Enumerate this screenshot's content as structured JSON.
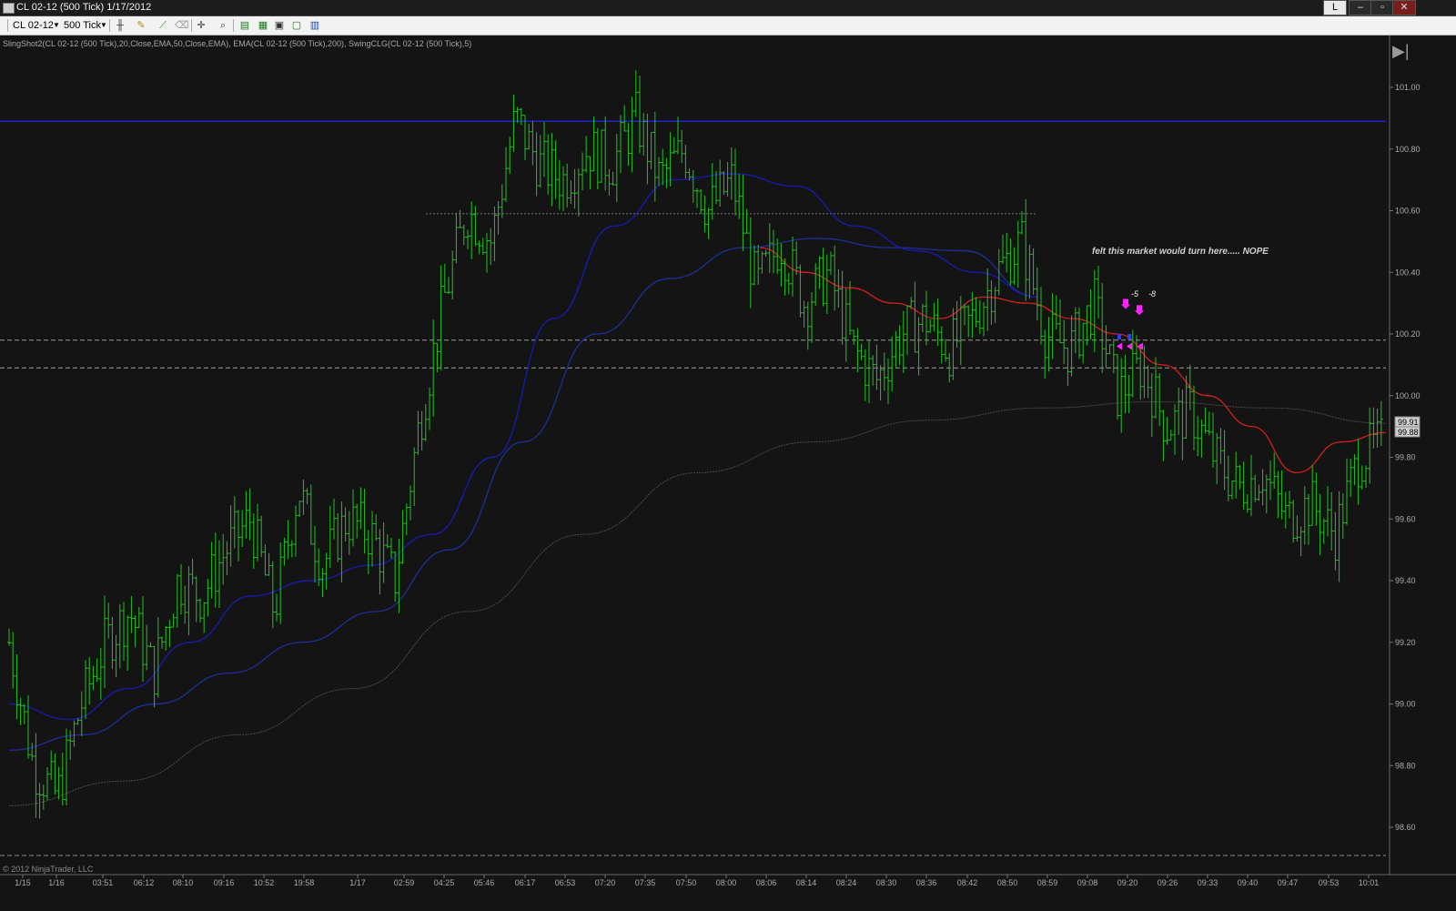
{
  "window": {
    "title": "CL 02-12 (500 Tick)  1/17/2012",
    "buttons": [
      "L",
      "–",
      "▫",
      "✕"
    ]
  },
  "toolbar": {
    "instrument": "CL 02-12",
    "interval": "500 Tick",
    "icons": [
      "bar-style-icon",
      "pencil-icon",
      "draw-line-icon",
      "eraser-icon",
      "crosshair-icon",
      "zoom-icon",
      "strategies-icon",
      "indicators-icon",
      "properties-icon",
      "data-box-icon",
      "tabs-icon"
    ]
  },
  "indicators_label": "SlingShot2(CL 02-12 (500 Tick),20,Close,EMA,50,Close,EMA), EMA(CL 02-12 (500 Tick),200), SwingCLG(CL 02-12 (500 Tick),5)",
  "copyright": "© 2012 NinjaTrader, LLC",
  "annotation": "felt this market would turn here..... NOPE",
  "trade_labels": [
    "-5",
    "-8"
  ],
  "last_prices": [
    "99.91",
    "99.88"
  ],
  "colors": {
    "background": "#141414",
    "bars": "#22c122",
    "fast_ema": "#1a1aa8",
    "slow_ema": "#1f2d8c",
    "ema200": "#4a4a4a",
    "red_ema": "#d41f1f",
    "horizontal_line": "#2222dd",
    "entry_marker": "#ff22ff"
  },
  "chart_data": {
    "type": "candlestick",
    "instrument": "CL 02-12 (500 Tick)",
    "ylim": [
      98.5,
      101.1
    ],
    "y_ticks": [
      "101.00",
      "100.80",
      "100.60",
      "100.40",
      "100.20",
      "100.00",
      "99.80",
      "99.60",
      "99.40",
      "99.20",
      "99.00",
      "98.80",
      "98.60"
    ],
    "x_ticks": [
      "1/15",
      "1/16",
      "03:51",
      "06:12",
      "08:10",
      "09:16",
      "10:52",
      "19:58",
      "1/17",
      "02:59",
      "04:25",
      "05:46",
      "06:17",
      "06:53",
      "07:20",
      "07:35",
      "07:50",
      "08:00",
      "08:06",
      "08:14",
      "08:24",
      "08:30",
      "08:36",
      "08:42",
      "08:50",
      "08:59",
      "09:08",
      "09:20",
      "09:26",
      "09:33",
      "09:40",
      "09:47",
      "09:53",
      "10:01"
    ],
    "price_path": [
      99.2,
      98.8,
      98.7,
      99.0,
      99.2,
      99.3,
      99.1,
      99.4,
      99.35,
      99.5,
      99.6,
      99.3,
      99.7,
      99.45,
      99.6,
      99.55,
      99.4,
      99.9,
      100.3,
      100.6,
      100.5,
      100.9,
      100.75,
      100.7,
      100.8,
      100.75,
      100.9,
      100.7,
      100.8,
      100.6,
      100.7,
      100.35,
      100.5,
      100.3,
      100.4,
      100.15,
      100.05,
      100.2,
      100.25,
      100.15,
      100.25,
      100.4,
      100.5,
      100.2,
      100.15,
      100.3,
      100.0,
      100.1,
      99.9,
      99.95,
      99.8,
      99.7,
      99.75,
      99.6,
      99.65,
      99.55,
      99.8,
      99.85
    ],
    "fast_ema_path": [
      99.0,
      98.95,
      99.05,
      99.2,
      99.35,
      99.4,
      99.45,
      99.55,
      99.8,
      100.25,
      100.55,
      100.7,
      100.72,
      100.68,
      100.55,
      100.47,
      100.4,
      100.32
    ],
    "slow_ema_path": [
      98.85,
      98.9,
      99.0,
      99.1,
      99.2,
      99.3,
      99.5,
      99.85,
      100.2,
      100.38,
      100.48,
      100.51,
      100.48,
      100.47,
      100.32
    ],
    "ema200_path": [
      98.67,
      98.75,
      98.9,
      99.05,
      99.3,
      99.55,
      99.75,
      99.85,
      99.92,
      99.96,
      99.98,
      99.96,
      99.91
    ],
    "red_ema_path": [
      100.48,
      100.4,
      100.35,
      100.3,
      100.25,
      100.32,
      100.3,
      100.25,
      100.2,
      100.1,
      100.0,
      99.9,
      99.75,
      99.85,
      99.88
    ],
    "swing_high_label": 100.58,
    "swing_low_label": 98.6,
    "horizontal_lines": [
      {
        "price": 100.89,
        "style": "solid",
        "color": "#2222dd"
      },
      {
        "price": 100.59,
        "style": "dotted",
        "color": "#777777"
      },
      {
        "price": 100.18,
        "style": "dashed",
        "color": "#999999"
      },
      {
        "price": 100.09,
        "style": "dashed",
        "color": "#999999"
      }
    ]
  }
}
